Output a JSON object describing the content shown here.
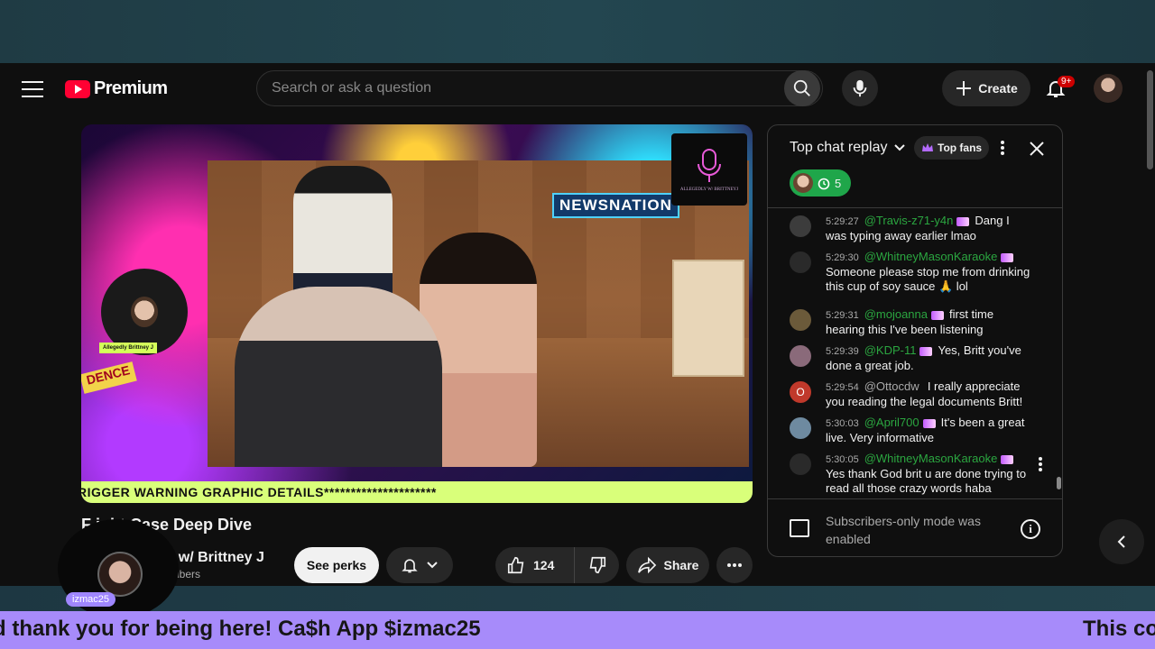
{
  "app": {
    "logo_text": "Premium"
  },
  "search": {
    "placeholder": "Search or ask a question"
  },
  "header": {
    "create_label": "Create",
    "notification_count": "9+"
  },
  "player": {
    "overlay_brand": "NEWSNATION",
    "logo_caption": "ALLEGEDLY W/ BRITTNEYJ",
    "host_tag": "Allegedly Brittney J",
    "evidence_text": "DENCE",
    "ticker": "RIGGER WARNING GRAPHIC DETAILS*********************"
  },
  "video": {
    "title": "F          ight Case Deep Dive",
    "channel": "ly w/ Brittney J",
    "subs": "scribers",
    "perks_label": "See perks",
    "like_count": "124",
    "share_label": "Share"
  },
  "chat": {
    "mode_label": "Top chat replay",
    "top_fans_label": "Top fans",
    "reaction_count": "5",
    "messages": [
      {
        "time": "5:29:27",
        "author": "@Travis-z71-y4n",
        "text": "Dang I was typing away earlier lmao",
        "avatar_color": "#3c3c3c"
      },
      {
        "time": "5:29:30",
        "author": "@WhitneyMasonKaraoke",
        "text": "Someone please stop me from drinking this cup of soy sauce 🙏 lol",
        "avatar_color": "#2a2a2a"
      },
      {
        "time": "5:29:31",
        "author": "@mojoanna",
        "text": "first time hearing this I've been listening",
        "avatar_color": "#6b5a3a"
      },
      {
        "time": "5:29:39",
        "author": "@KDP-11",
        "text": "Yes, Britt you've done a great job.",
        "avatar_color": "#8a6a7a"
      },
      {
        "time": "5:29:54",
        "author": "@Ottocdw",
        "text": "I really appreciate you reading the legal documents Britt!",
        "avatar_color": "#c0392b",
        "avatar_letter": "O"
      },
      {
        "time": "5:30:03",
        "author": "@April700",
        "text": "It's been a great live. Very informative",
        "avatar_color": "#6e8aa0"
      },
      {
        "time": "5:30:05",
        "author": "@WhitneyMasonKaraoke",
        "text": "Yes thank God brit u are done trying to read all those crazy words haba",
        "avatar_color": "#2a2a2a"
      }
    ],
    "footer_text": "Subscribers-only mode was enabled"
  },
  "overlays": {
    "webcam_tag": "izmac25",
    "marquee_left": "d thank you for being here! Ca$h App $izmac25",
    "marquee_right": "This co"
  },
  "colors": {
    "youtube_red": "#ff0033",
    "chat_author_green": "#2ba640",
    "reaction_green": "#1fa64a",
    "marquee_purple": "#a78bfa",
    "ticker_lime": "#d9ff7a"
  }
}
